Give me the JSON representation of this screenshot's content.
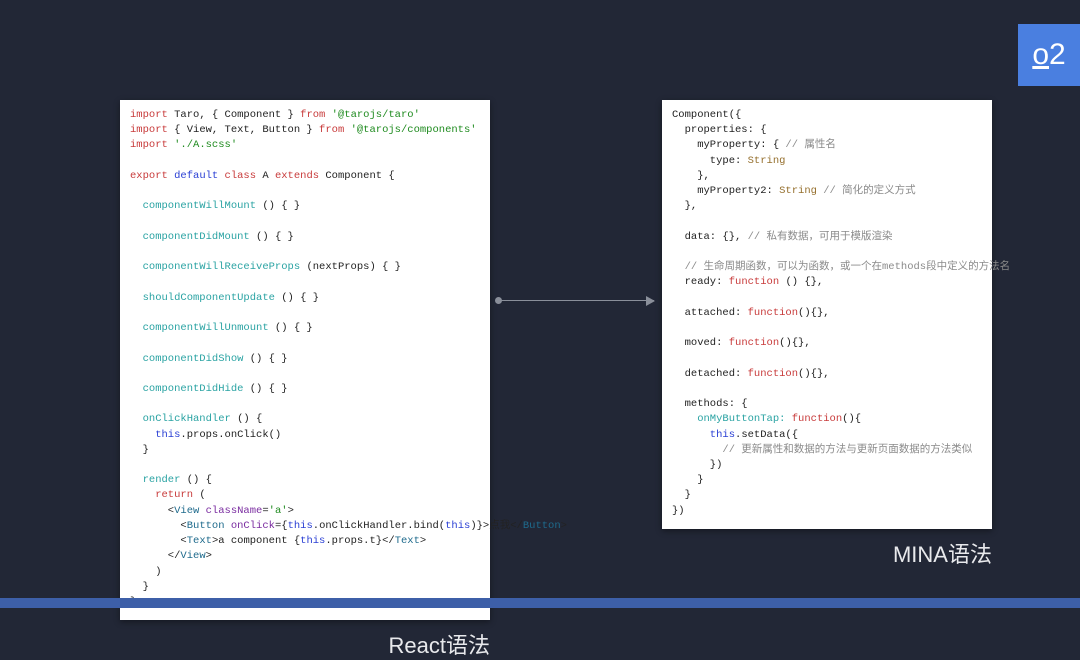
{
  "badge": "02",
  "arrow": "→",
  "left": {
    "caption": "React语法",
    "code": {
      "l1a": "import",
      "l1b": " Taro, { Component } ",
      "l1c": "from",
      "l1d": " '@tarojs/taro'",
      "l2a": "import",
      "l2b": " { View, Text, Button } ",
      "l2c": "from",
      "l2d": " '@tarojs/components'",
      "l3a": "import",
      "l3b": " './A.scss'",
      "l4a": "export ",
      "l4b": "default ",
      "l4c": "class",
      "l4d": " A ",
      "l4e": "extends",
      "l4f": " Component {",
      "m1": "  componentWillMount",
      "m1b": " () { }",
      "m2": "  componentDidMount",
      "m2b": " () { }",
      "m3": "  componentWillReceiveProps",
      "m3b": " (nextProps) { }",
      "m4": "  shouldComponentUpdate",
      "m4b": " () { }",
      "m5": "  componentWillUnmount",
      "m5b": " () { }",
      "m6": "  componentDidShow",
      "m6b": " () { }",
      "m7": "  componentDidHide",
      "m7b": " () { }",
      "c1": "  onClickHandler",
      "c1b": " () {",
      "c2a": "    this",
      "c2b": ".props.onClick()",
      "c3": "  }",
      "r1": "  render",
      "r1b": " () {",
      "r2a": "    return",
      "r2b": " (",
      "r3a": "      <",
      "r3b": "View",
      "r3c": " className",
      "r3d": "=",
      "r3e": "'a'",
      "r3f": ">",
      "r4a": "        <",
      "r4b": "Button",
      "r4c": " onClick",
      "r4d": "={",
      "r4e": "this",
      "r4f": ".onClickHandler.bind(",
      "r4g": "this",
      "r4h": ")}>点我</",
      "r4i": "Button",
      "r4j": ">",
      "r5a": "        <",
      "r5b": "Text",
      "r5c": ">a component {",
      "r5d": "this",
      "r5e": ".props.t}</",
      "r5f": "Text",
      "r5g": ">",
      "r6a": "      </",
      "r6b": "View",
      "r6c": ">",
      "r7": "    )",
      "r8": "  }",
      "r9": "}"
    }
  },
  "right": {
    "caption": "MINA语法",
    "code": {
      "l1": "Component({",
      "l2": "  properties: {",
      "l3a": "    myProperty: { ",
      "l3b": "// 属性名",
      "l4a": "      type: ",
      "l4b": "String",
      "l5": "    },",
      "l6a": "    myProperty2: ",
      "l6b": "String",
      "l6c": " // 简化的定义方式",
      "l7": "  },",
      "d1a": "  data: {}, ",
      "d1b": "// 私有数据，可用于模版渲染",
      "c1": "  // 生命周期函数，可以为函数，或一个在methods段中定义的方法名",
      "f1a": "  ready: ",
      "f1b": "function",
      "f1c": " () {},",
      "f2a": "  attached: ",
      "f2b": "function",
      "f2c": "(){},",
      "f3a": "  moved: ",
      "f3b": "function",
      "f3c": "(){},",
      "f4a": "  detached: ",
      "f4b": "function",
      "f4c": "(){},",
      "m1": "  methods: {",
      "m2a": "    onMyButtonTap: ",
      "m2b": "function",
      "m2c": "(){",
      "m3a": "      this",
      "m3b": ".setData({",
      "m4": "        // 更新属性和数据的方法与更新页面数据的方法类似",
      "m5": "      })",
      "m6": "    }",
      "m7": "  }",
      "m8": "})"
    }
  }
}
